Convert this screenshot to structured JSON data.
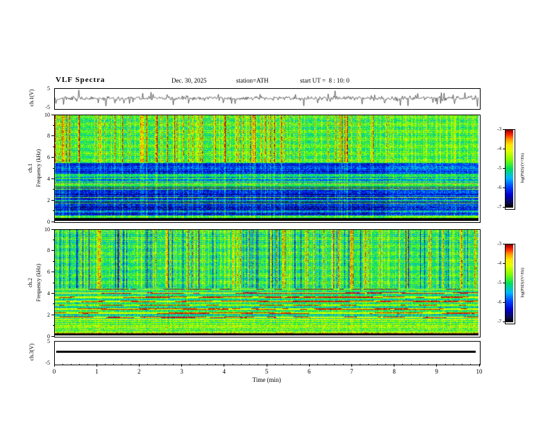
{
  "header": {
    "title": "VLF Spectra",
    "date": "Dec. 30, 2025",
    "station": "station=ATH",
    "start_ut": "start UT =  8 : 10: 0"
  },
  "panels": {
    "ch1_wave": {
      "ylabel": "ch.1(V)",
      "ymax": "5",
      "ymin": "-5"
    },
    "ch1_spec": {
      "channel": "ch.1",
      "ylabel": "Frequency (kHz)",
      "yticks": [
        "10",
        "8",
        "6",
        "4",
        "2",
        "0"
      ]
    },
    "ch2_spec": {
      "channel": "ch.2",
      "ylabel": "Frequency (kHz)",
      "yticks": [
        "10",
        "8",
        "6",
        "4",
        "2",
        "0"
      ]
    },
    "ch3_wave": {
      "ylabel": "ch.3(V)",
      "ymax": "5",
      "ymin": "-5"
    }
  },
  "xaxis": {
    "label": "Time (min)",
    "ticks": [
      "0",
      "1",
      "2",
      "3",
      "4",
      "5",
      "6",
      "7",
      "8",
      "9",
      "10"
    ]
  },
  "colorbar": {
    "label": "log(PSD)/(V²/Hz)",
    "ticks": [
      "-3",
      "-4",
      "-5",
      "-6",
      "-7"
    ]
  },
  "chart_data": [
    {
      "type": "line",
      "title": "ch.1 voltage waveform",
      "xlabel": "Time (min)",
      "ylabel": "ch.1(V)",
      "xlim": [
        0,
        10
      ],
      "ylim": [
        -5,
        5
      ],
      "description": "Continuous noisy VLF voltage trace centered near 0 V with dense impulsive sferic spikes reaching roughly ±4 V throughout the 10 minute record."
    },
    {
      "type": "heatmap",
      "title": "ch.1 VLF spectrogram",
      "xlabel": "Time (min)",
      "ylabel": "Frequency (kHz)",
      "xlim": [
        0,
        10
      ],
      "ylim": [
        0,
        10
      ],
      "zlabel": "log(PSD)/(V²/Hz)",
      "zlim": [
        -7,
        -3
      ],
      "colormap": "jet with black floor",
      "legend_position": "right colorbar",
      "grid": false,
      "quiet_after_min": 7.9,
      "bands": [
        {
          "f0": 0.0,
          "f1": 0.25,
          "z": -7.3,
          "note": "black cutoff band below ~250 Hz"
        },
        {
          "f0": 0.25,
          "f1": 0.5,
          "z": -4.8,
          "note": "bright narrow line just above cutoff"
        },
        {
          "f0": 0.5,
          "f1": 3.2,
          "z": -6.3,
          "note": "low-power blue region with horizontal striping"
        },
        {
          "f0": 3.2,
          "f1": 4.5,
          "z": -5.7,
          "note": "green harmonic lines over blue background near 3.3-4.3 kHz"
        },
        {
          "f0": 4.5,
          "f1": 5.55,
          "z": -6.1,
          "note": "dark blue region"
        },
        {
          "f0": 5.55,
          "f1": 10.0,
          "z": -4.85,
          "note": "green hiss band with dense vertical sferic streaks up to -3"
        }
      ],
      "harmonics": {
        "range": [
          3.25,
          4.4
        ],
        "start": 3.35,
        "step": 0.33,
        "halfwidth": 0.06,
        "z": -4.9
      },
      "streaks": {
        "density": 0.3,
        "boost_min": 0.35,
        "boost_max": 1.9,
        "strong_above_kHz": 5.55,
        "low_weight": 0.35
      }
    },
    {
      "type": "heatmap",
      "title": "ch.2 VLF spectrogram",
      "xlabel": "Time (min)",
      "ylabel": "Frequency (kHz)",
      "xlim": [
        0,
        10
      ],
      "ylim": [
        0,
        10
      ],
      "zlabel": "log(PSD)/(V²/Hz)",
      "zlim": [
        -7,
        -3
      ],
      "colormap": "jet with black floor",
      "legend_position": "right colorbar",
      "grid": false,
      "bands": [
        {
          "f0": 0.0,
          "f1": 0.18,
          "z": -7.3,
          "note": "black cutoff band"
        },
        {
          "f0": 0.18,
          "f1": 0.32,
          "z": -4.3,
          "note": "bright line near 250 Hz"
        },
        {
          "f0": 0.32,
          "f1": 1.6,
          "z": -4.55,
          "note": "bright yellow-green band with fine horizontal striping"
        },
        {
          "f0": 1.6,
          "f1": 4.45,
          "z": -5.05,
          "note": "green region with bright power-line harmonic rows every ~0.38 kHz, occasional red bursts"
        },
        {
          "f0": 4.45,
          "f1": 10.0,
          "z": -4.95,
          "note": "green hiss with bright and dark vertical sferic streaks"
        }
      ],
      "harmonics": {
        "range": [
          1.65,
          4.4
        ],
        "start": 1.72,
        "step": 0.38,
        "halfwidth": 0.06,
        "z": -4.15,
        "red_prob": 0.1,
        "red_z": -3.15
      },
      "streaks": {
        "density": 0.3,
        "boost_min": 0.3,
        "boost_max": 1.6,
        "strong_above_kHz": 4.45,
        "low_weight": 0.18,
        "dark_density": 0.1,
        "dark_max": 1.4
      }
    },
    {
      "type": "line",
      "title": "ch.3 voltage waveform",
      "xlabel": "Time (min)",
      "ylabel": "ch.3(V)",
      "xlim": [
        0,
        10
      ],
      "ylim": [
        -5,
        5
      ],
      "description": "Flat thick trace at 0 V for the entire record (channel inactive)."
    }
  ]
}
